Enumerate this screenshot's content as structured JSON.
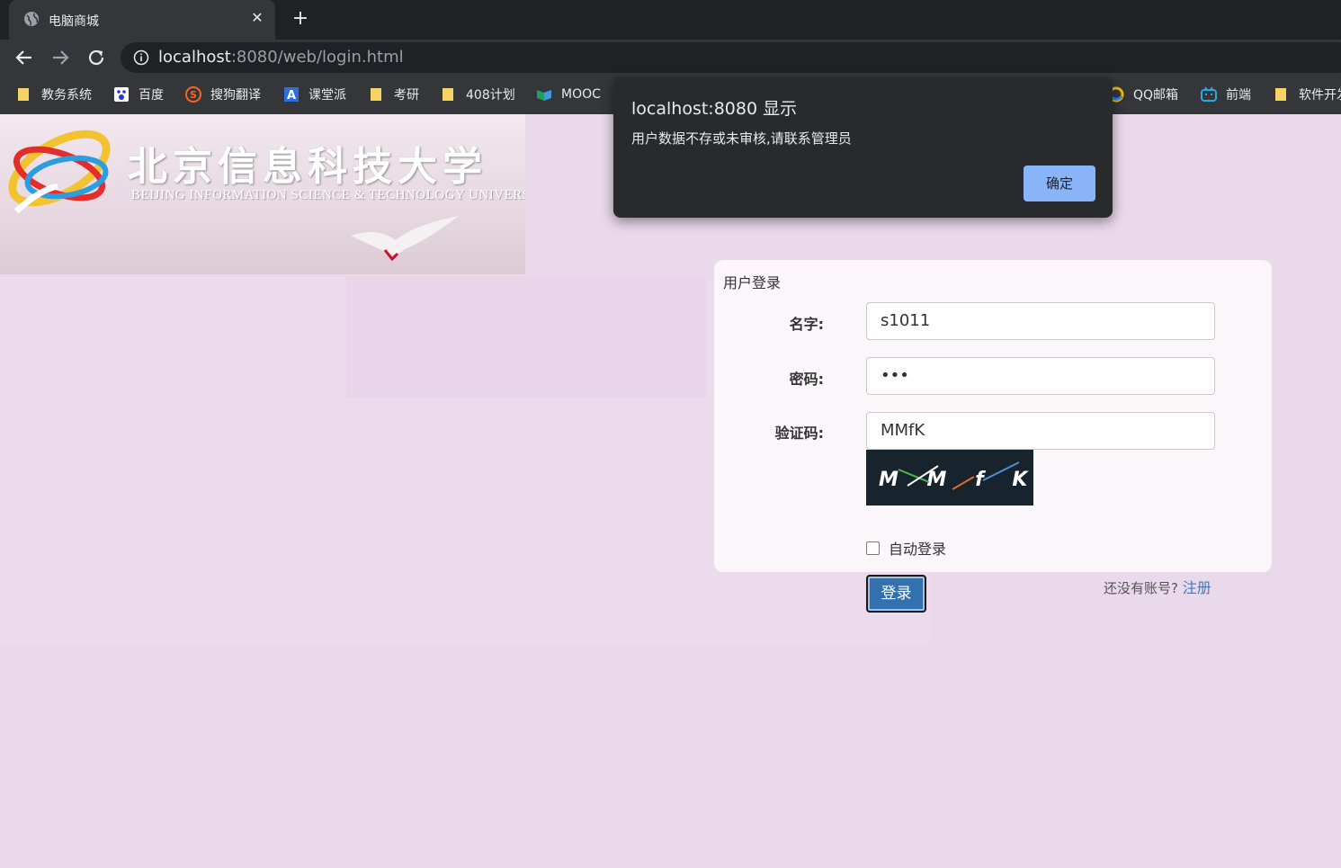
{
  "browser": {
    "tab_title": "电脑商城",
    "url_host": "localhost",
    "url_rest": ":8080/web/login.html",
    "bookmarks": [
      {
        "label": "教务系统",
        "icon": "folder-icon"
      },
      {
        "label": "百度",
        "icon": "baidu-icon"
      },
      {
        "label": "搜狗翻译",
        "icon": "sogou-icon"
      },
      {
        "label": "课堂派",
        "icon": "ketangpai-icon"
      },
      {
        "label": "考研",
        "icon": "folder-icon"
      },
      {
        "label": "408计划",
        "icon": "folder-icon"
      },
      {
        "label": "MOOC",
        "icon": "mooc-icon"
      },
      {
        "label": "QQ邮箱",
        "icon": "qqmail-icon"
      },
      {
        "label": "前端",
        "icon": "bilibili-icon"
      },
      {
        "label": "软件开发",
        "icon": "folder-icon"
      }
    ]
  },
  "banner": {
    "title_cn": "北京信息科技大学",
    "title_en": "BEIJING INFORMATION SCIENCE & TECHNOLOGY UNIVERSITY"
  },
  "login": {
    "card_title": "用户登录",
    "name_label": "名字:",
    "name_value": "s1011",
    "password_label": "密码:",
    "password_value": "•••",
    "captcha_label": "验证码:",
    "captcha_value": "MMfK",
    "captcha_image_text": "M M f K",
    "auto_login_label": "自动登录",
    "login_button": "登录",
    "no_account_text": "还没有账号?",
    "register_link": "注册"
  },
  "dialog": {
    "title": "localhost:8080 显示",
    "message": "用户数据不存或未审核,请联系管理员",
    "ok_button": "确定"
  },
  "colors": {
    "page_bg": "#ead8eb",
    "chrome_bg": "#35363a",
    "dialog_bg": "#292a2d",
    "dialog_button": "#8ab4f8",
    "login_button": "#3271ae"
  }
}
